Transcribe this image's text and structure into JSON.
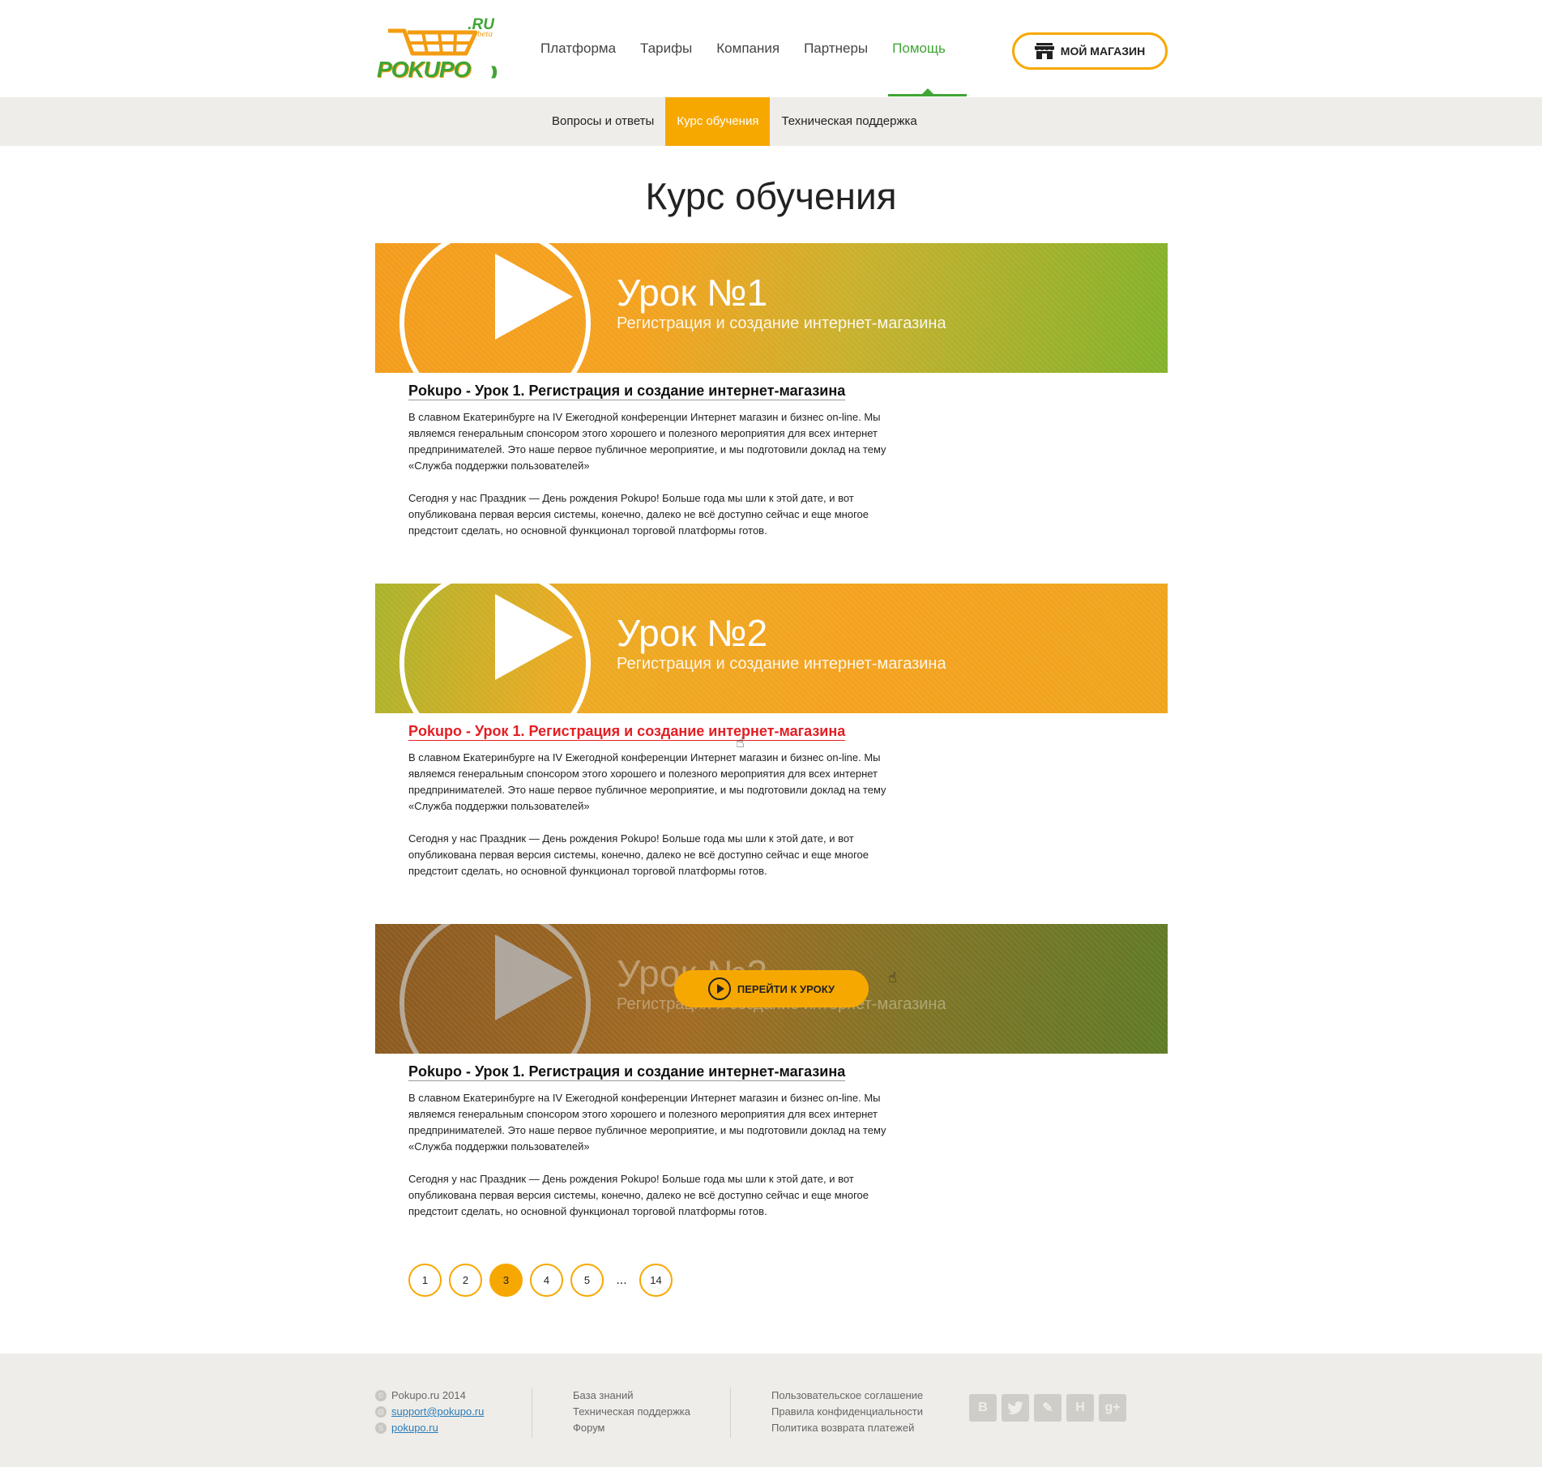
{
  "brand": {
    "logo_text": "POKUPO",
    "logo_ru": ".RU",
    "logo_beta": "beta"
  },
  "nav": {
    "items": [
      "Платформа",
      "Тарифы",
      "Компания",
      "Партнеры",
      "Помощь"
    ],
    "active": "Помощь",
    "my_shop_label": "МОЙ МАГАЗИН"
  },
  "subnav": {
    "items": [
      "Вопросы и ответы",
      "Курс обучения",
      "Техническая поддержка"
    ],
    "active": "Курс обучения"
  },
  "page_title": "Курс обучения",
  "lessons": [
    {
      "banner_title": "Урок №1",
      "banner_subtitle": "Регистрация и создание интернет-магазина",
      "heading": "Pokupo - Урок 1. Регистрация и создание интернет-магазина",
      "paragraphs": [
        "В славном Екатеринбурге на IV Ежегодной конференции Интернет магазин и бизнес on-line. Мы являемся генеральным спонсором этого хорошего и полезного мероприятия для всех интернет предпринимателей. Это наше первое публичное мероприятие, и мы подготовили доклад на тему «Служба поддержки пользователей»",
        "Сегодня у нас Праздник — День рождения Pokupo! Больше года мы шли к этой дате, и вот опубликована первая версия системы, конечно, далеко не всё доступно сейчас и еще многое предстоит сделать, но основной функционал торговой платформы готов."
      ]
    },
    {
      "banner_title": "Урок №2",
      "banner_subtitle": "Регистрация и создание интернет-магазина",
      "heading": "Pokupo - Урок 1. Регистрация и создание интернет-магазина",
      "paragraphs": [
        "В славном Екатеринбурге на IV Ежегодной конференции Интернет магазин и бизнес on-line. Мы являемся генеральным спонсором этого хорошего и полезного мероприятия для всех интернет предпринимателей. Это наше первое публичное мероприятие, и мы подготовили доклад на тему «Служба поддержки пользователей»",
        "Сегодня у нас Праздник — День рождения Pokupo! Больше года мы шли к этой дате, и вот опубликована первая версия системы, конечно, далеко не всё доступно сейчас и еще многое предстоит сделать, но основной функционал торговой платформы готов."
      ]
    },
    {
      "banner_title": "Урок №3",
      "banner_subtitle": "Регистрация и создание интернет-магазина",
      "go_button": "ПЕРЕЙТИ К УРОКУ",
      "heading": "Pokupo - Урок 1. Регистрация и создание интернет-магазина",
      "paragraphs": [
        "В славном Екатеринбурге на IV Ежегодной конференции Интернет магазин и бизнес on-line. Мы являемся генеральным спонсором этого хорошего и полезного мероприятия для всех интернет предпринимателей. Это наше первое публичное мероприятие, и мы подготовили доклад на тему «Служба поддержки пользователей»",
        "Сегодня у нас Праздник — День рождения Pokupo! Больше года мы шли к этой дате, и вот опубликована первая версия системы, конечно, далеко не всё доступно сейчас и еще многое предстоит сделать, но основной функционал торговой платформы готов."
      ]
    }
  ],
  "pagination": {
    "pages": [
      "1",
      "2",
      "3",
      "4",
      "5"
    ],
    "ellipsis": "...",
    "last": "14",
    "current": "3"
  },
  "footer": {
    "copyright": "Pokupo.ru 2014",
    "email": "support@pokupo.ru",
    "skype": "pokupo.ru",
    "col2": [
      "База знаний",
      "Техническая поддержка",
      "Форум"
    ],
    "col3": [
      "Пользовательское соглашение",
      "Правила конфиденциальности",
      "Политика возврата платежей"
    ],
    "socials": [
      "vk-icon",
      "twitter-icon",
      "livejournal-icon",
      "habrahabr-icon",
      "googleplus-icon"
    ]
  },
  "colors": {
    "accent": "#f7a800",
    "green": "#3fa535",
    "hover_red": "#e31e24",
    "footer_bg": "#eeede9"
  }
}
